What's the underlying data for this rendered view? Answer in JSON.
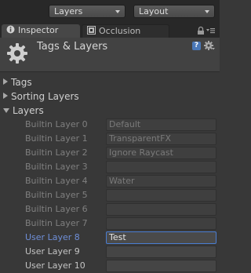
{
  "toolbar": {
    "layers_dropdown": "Layers",
    "layout_dropdown": "Layout"
  },
  "tabs": {
    "inspector": "Inspector",
    "occlusion": "Occlusion"
  },
  "header": {
    "title": "Tags & Layers"
  },
  "sections": {
    "tags": "Tags",
    "sorting_layers": "Sorting Layers",
    "layers": "Layers"
  },
  "layers": [
    {
      "label": "Builtin Layer 0",
      "value": "Default",
      "kind": "builtin"
    },
    {
      "label": "Builtin Layer 1",
      "value": "TransparentFX",
      "kind": "builtin"
    },
    {
      "label": "Builtin Layer 2",
      "value": "Ignore Raycast",
      "kind": "builtin"
    },
    {
      "label": "Builtin Layer 3",
      "value": "",
      "kind": "builtin"
    },
    {
      "label": "Builtin Layer 4",
      "value": "Water",
      "kind": "builtin"
    },
    {
      "label": "Builtin Layer 5",
      "value": "",
      "kind": "builtin"
    },
    {
      "label": "Builtin Layer 6",
      "value": "",
      "kind": "builtin"
    },
    {
      "label": "Builtin Layer 7",
      "value": "",
      "kind": "builtin"
    },
    {
      "label": "User Layer 8",
      "value": "Test",
      "kind": "focused"
    },
    {
      "label": "User Layer 9",
      "value": "",
      "kind": "user"
    },
    {
      "label": "User Layer 10",
      "value": "",
      "kind": "user"
    }
  ]
}
